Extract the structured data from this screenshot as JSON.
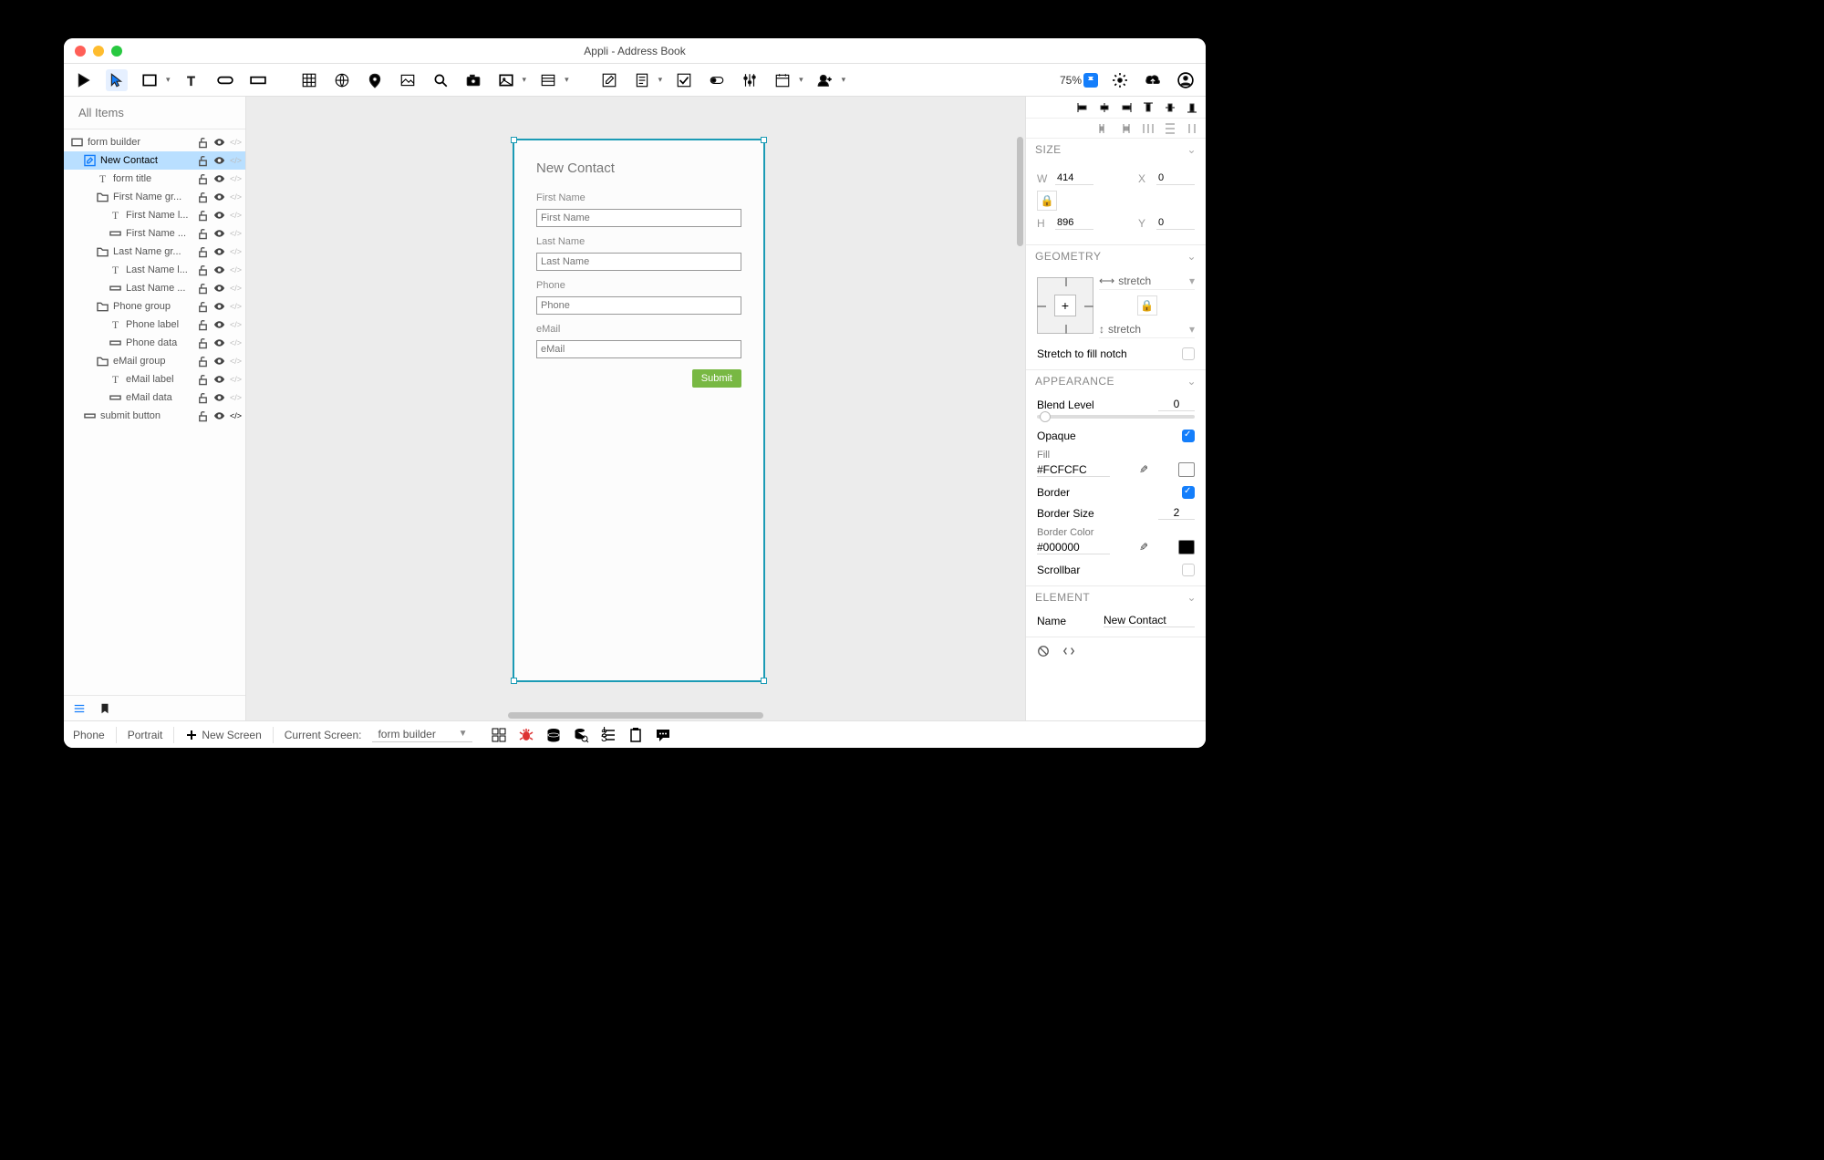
{
  "window_title": "Appli - Address Book",
  "toolbar": {
    "zoom": "75%"
  },
  "sidebar": {
    "search_placeholder": "All Items",
    "items": [
      {
        "label": "form builder",
        "indent": 1,
        "icon": "rect",
        "sel": false,
        "code": "</>"
      },
      {
        "label": "New Contact",
        "indent": 2,
        "icon": "edit",
        "sel": true,
        "code": "</>"
      },
      {
        "label": "form title",
        "indent": 3,
        "icon": "T",
        "sel": false,
        "code": "</>"
      },
      {
        "label": "First Name gr...",
        "indent": 3,
        "icon": "folder",
        "sel": false,
        "code": "</>"
      },
      {
        "label": "First Name l...",
        "indent": 4,
        "icon": "T",
        "sel": false,
        "code": "</>"
      },
      {
        "label": "First Name ...",
        "indent": 4,
        "icon": "field",
        "sel": false,
        "code": "</>"
      },
      {
        "label": "Last Name gr...",
        "indent": 3,
        "icon": "folder",
        "sel": false,
        "code": "</>"
      },
      {
        "label": "Last Name l...",
        "indent": 4,
        "icon": "T",
        "sel": false,
        "code": "</>"
      },
      {
        "label": "Last Name ...",
        "indent": 4,
        "icon": "field",
        "sel": false,
        "code": "</>"
      },
      {
        "label": "Phone group",
        "indent": 3,
        "icon": "folder",
        "sel": false,
        "code": "</>"
      },
      {
        "label": "Phone label",
        "indent": 4,
        "icon": "T",
        "sel": false,
        "code": "</>"
      },
      {
        "label": "Phone data",
        "indent": 4,
        "icon": "field",
        "sel": false,
        "code": "</>"
      },
      {
        "label": "eMail group",
        "indent": 3,
        "icon": "folder",
        "sel": false,
        "code": "</>"
      },
      {
        "label": "eMail label",
        "indent": 4,
        "icon": "T",
        "sel": false,
        "code": "</>"
      },
      {
        "label": "eMail data",
        "indent": 4,
        "icon": "field",
        "sel": false,
        "code": "</>"
      },
      {
        "label": "submit button",
        "indent": 2,
        "icon": "field",
        "sel": false,
        "code": "</>"
      }
    ]
  },
  "canvas": {
    "form_title": "New Contact",
    "fields": [
      {
        "label": "First Name",
        "placeholder": "First Name"
      },
      {
        "label": "Last Name",
        "placeholder": "Last Name"
      },
      {
        "label": "Phone",
        "placeholder": "Phone"
      },
      {
        "label": "eMail",
        "placeholder": "eMail"
      }
    ],
    "submit_label": "Submit"
  },
  "props": {
    "size_hdr": "SIZE",
    "w_lbl": "W",
    "w": "414",
    "x_lbl": "X",
    "x": "0",
    "h_lbl": "H",
    "h": "896",
    "y_lbl": "Y",
    "y": "0",
    "geo_hdr": "GEOMETRY",
    "stretch1": "stretch",
    "stretch2": "stretch",
    "notch_label": "Stretch to fill notch",
    "app_hdr": "APPEARANCE",
    "blend_label": "Blend Level",
    "blend_val": "0",
    "opaque_label": "Opaque",
    "fill_label": "Fill",
    "fill_val": "#FCFCFC",
    "border_label": "Border",
    "border_size_label": "Border Size",
    "border_size": "2",
    "border_color_label": "Border Color",
    "border_color": "#000000",
    "scrollbar_label": "Scrollbar",
    "elem_hdr": "ELEMENT",
    "name_label": "Name",
    "name_val": "New Contact"
  },
  "statusbar": {
    "device": "Phone",
    "orient": "Portrait",
    "new_screen": "New Screen",
    "current_label": "Current Screen:",
    "current_val": "form builder"
  }
}
